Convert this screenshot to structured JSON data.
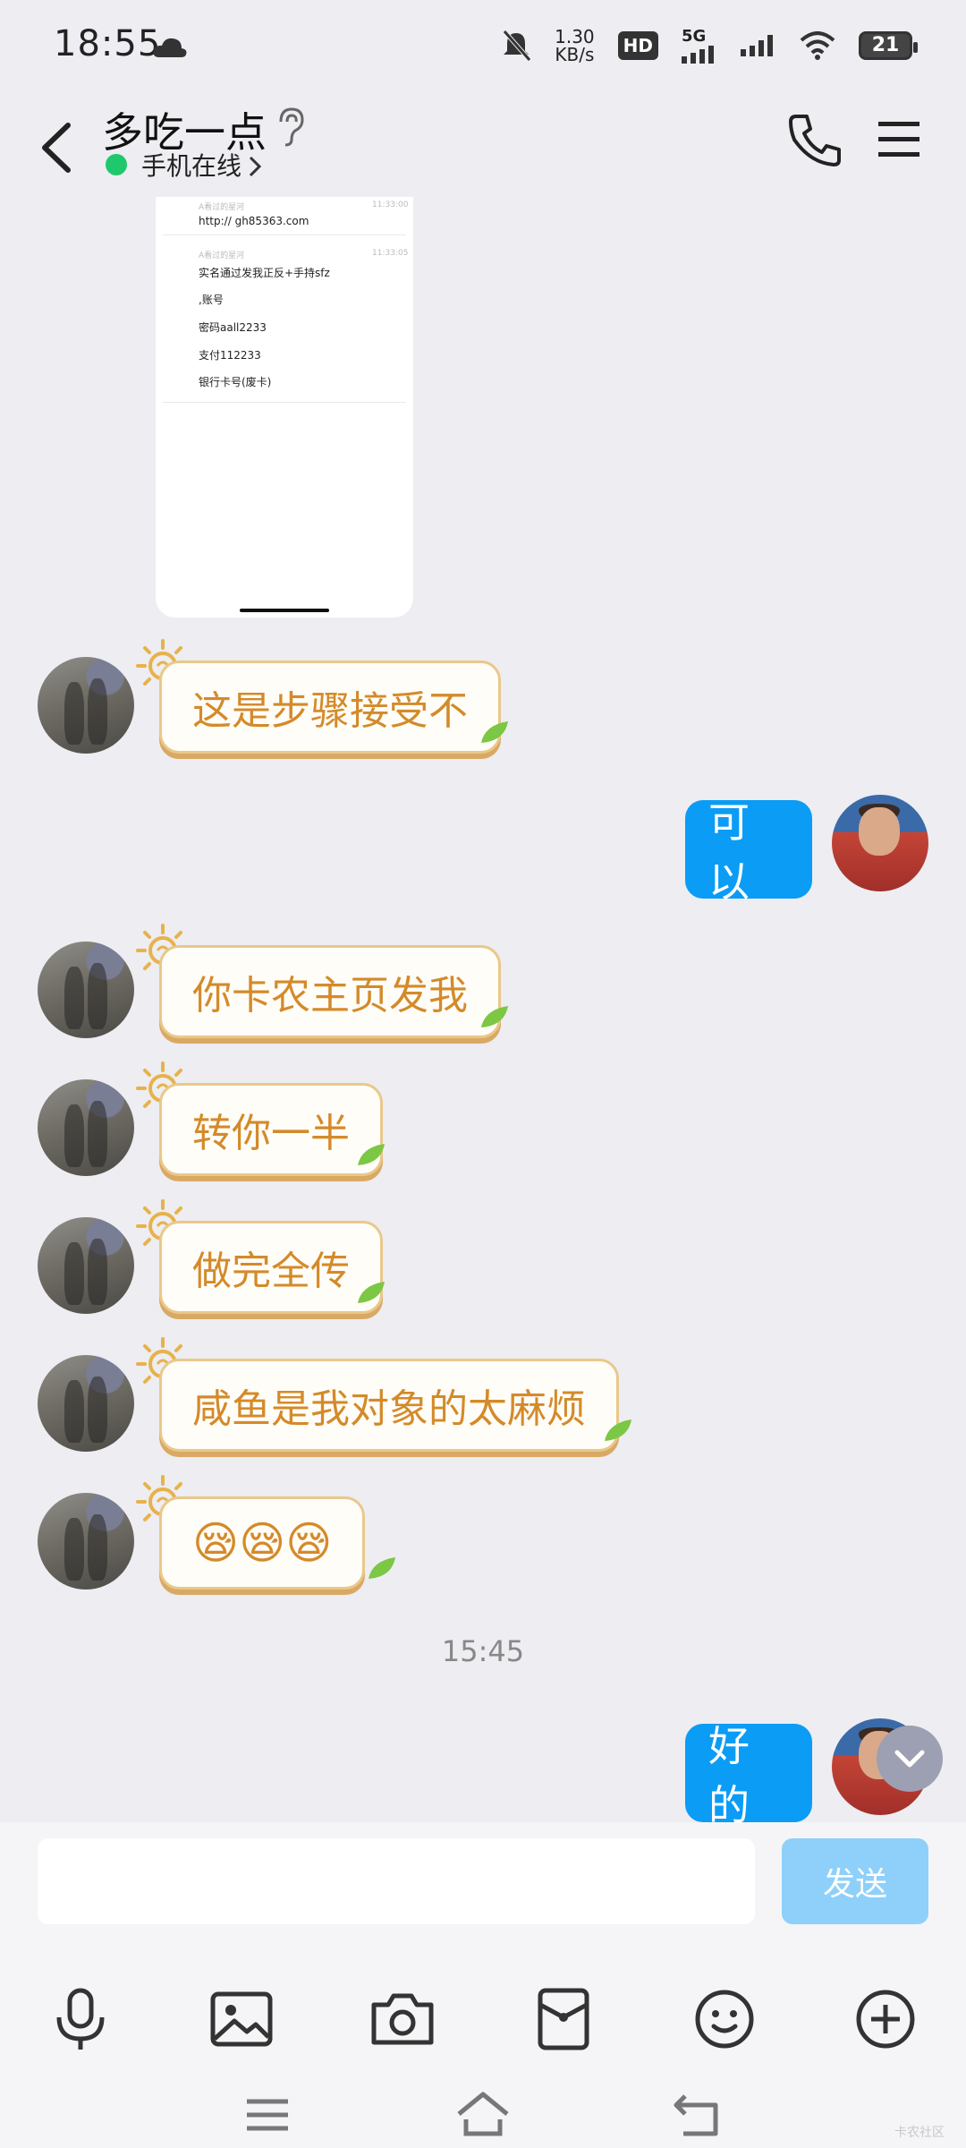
{
  "status": {
    "time": "18:55",
    "net_speed_value": "1.30",
    "net_speed_unit": "KB/s",
    "hd_label": "HD",
    "sim_label": "5G",
    "battery": "21"
  },
  "header": {
    "title": "多吃一点",
    "online_status": "手机在线"
  },
  "screenshot": {
    "lines": [
      {
        "meta": "A看过的星河",
        "time": "11:33:00",
        "text": "http:// gh85363.com"
      },
      {
        "meta": "A看过的星河",
        "time": "11:33:05",
        "text": "实名通过发我正反+手持sfz"
      },
      {
        "text": ",账号"
      },
      {
        "text": "密码aall2233"
      },
      {
        "text": "支付112233"
      },
      {
        "text": "银行卡号(废卡)"
      }
    ]
  },
  "messages": [
    {
      "from": "other",
      "text": "这是步骤接受不"
    },
    {
      "from": "me",
      "text": "可以"
    },
    {
      "from": "other",
      "text": "你卡农主页发我"
    },
    {
      "from": "other",
      "text": "转你一半"
    },
    {
      "from": "other",
      "text": "做完全传"
    },
    {
      "from": "other",
      "text": "咸鱼是我对象的太麻烦"
    },
    {
      "from": "other",
      "text": "😪😪😪"
    },
    {
      "timestamp": "15:45"
    },
    {
      "from": "me",
      "text": "好的"
    }
  ],
  "composer": {
    "input_value": "",
    "send_label": "发送"
  },
  "watermark": "卡农社区",
  "colors": {
    "accent_blue": "#0b9cf5",
    "bubble_text_orange": "#d48a2a",
    "online_green": "#1fc96b"
  }
}
